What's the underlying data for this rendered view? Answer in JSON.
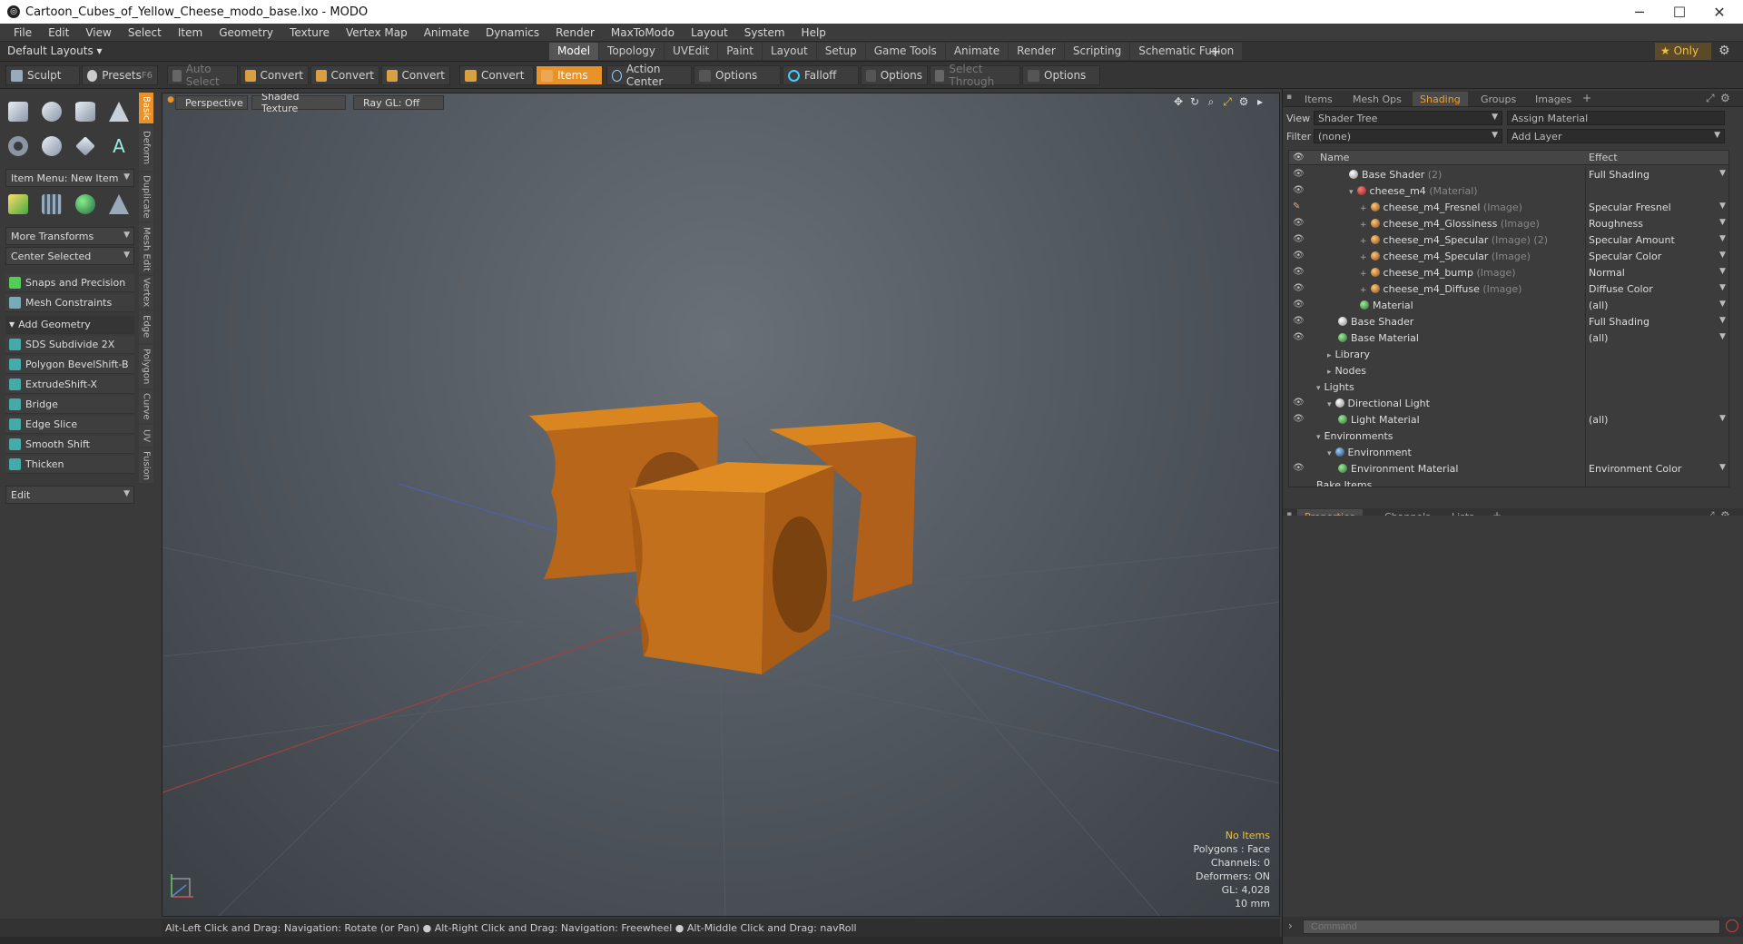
{
  "window": {
    "title": "Cartoon_Cubes_of_Yellow_Cheese_modo_base.lxo - MODO"
  },
  "menu": [
    "File",
    "Edit",
    "View",
    "Select",
    "Item",
    "Geometry",
    "Texture",
    "Vertex Map",
    "Animate",
    "Dynamics",
    "Render",
    "MaxToModo",
    "Layout",
    "System",
    "Help"
  ],
  "layoutbar": {
    "default_layouts": "Default Layouts ▾",
    "tabs": [
      "Model",
      "Topology",
      "UVEdit",
      "Paint",
      "Layout",
      "Setup",
      "Game Tools",
      "Animate",
      "Render",
      "Scripting",
      "Schematic Fusion"
    ],
    "active_tab": "Model",
    "only_label": "★  Only"
  },
  "toolbar": {
    "sculpt": "Sculpt",
    "presets": "Presets",
    "presets_key": "F6",
    "auto_select": "Auto Select",
    "convert": "Convert",
    "items": "Items",
    "action_center": "Action Center",
    "options": "Options",
    "falloff": "Falloff",
    "select_through": "Select Through"
  },
  "leftpanel": {
    "item_menu": "Item Menu: New Item",
    "more_transforms": "More Transforms",
    "center_selected": "Center Selected",
    "snaps": "Snaps and Precision",
    "mesh_constraints": "Mesh Constraints",
    "add_geometry": "Add Geometry",
    "tools": [
      {
        "label": "SDS Subdivide 2X",
        "key": ""
      },
      {
        "label": "Polygon Bevel",
        "key": "Shift-B"
      },
      {
        "label": "Extrude",
        "key": "Shift-X"
      },
      {
        "label": "Bridge",
        "key": ""
      },
      {
        "label": "Edge Slice",
        "key": ""
      },
      {
        "label": "Smooth Shift",
        "key": ""
      },
      {
        "label": "Thicken",
        "key": ""
      }
    ],
    "edit": "Edit",
    "vtabs": [
      "Basic",
      "Deform",
      "Duplicate",
      "Mesh Edit",
      "Vertex",
      "Edge",
      "Polygon",
      "Curve",
      "UV",
      "Fusion"
    ]
  },
  "viewport": {
    "perspective": "Perspective",
    "shading": "Shaded Texture",
    "raygl": "Ray GL: Off",
    "stats": {
      "no_items": "No Items",
      "polygons": "Polygons : Face",
      "channels": "Channels: 0",
      "deformers": "Deformers: ON",
      "gl": "GL: 4,028",
      "unit": "10 mm"
    }
  },
  "statusbar": "Alt-Left Click and Drag: Navigation: Rotate (or Pan) ● Alt-Right Click and Drag: Navigation: Freewheel ● Alt-Middle Click and Drag: navRoll",
  "rightpanel": {
    "tabs": [
      "Items",
      "Mesh Ops",
      "Shading",
      "Groups",
      "Images"
    ],
    "active_tab": "Shading",
    "view_label": "View",
    "view_value": "Shader Tree",
    "assign_material": "Assign Material",
    "filter_label": "Filter",
    "filter_value": "(none)",
    "add_layer": "Add Layer",
    "col_name": "Name",
    "col_effect": "Effect",
    "tree": [
      {
        "name": "Base Shader",
        "tag": "(2)",
        "effect": "Full Shading",
        "indent": 3,
        "ball": "white",
        "eye": true,
        "exp": ""
      },
      {
        "name": "cheese_m4",
        "tag": "(Material)",
        "effect": "",
        "indent": 3,
        "ball": "red",
        "eye": true,
        "exp": "▾"
      },
      {
        "name": "cheese_m4_Fresnel",
        "tag": "(Image)",
        "effect": "Specular Fresnel",
        "indent": 4,
        "ball": "img",
        "eye": false,
        "brush": true,
        "exp": "+"
      },
      {
        "name": "cheese_m4_Glossiness",
        "tag": "(Image)",
        "effect": "Roughness",
        "indent": 4,
        "ball": "img",
        "eye": true,
        "exp": "+"
      },
      {
        "name": "cheese_m4_Specular",
        "tag": "(Image) (2)",
        "effect": "Specular Amount",
        "indent": 4,
        "ball": "img",
        "eye": true,
        "exp": "+"
      },
      {
        "name": "cheese_m4_Specular",
        "tag": "(Image)",
        "effect": "Specular Color",
        "indent": 4,
        "ball": "img",
        "eye": true,
        "exp": "+"
      },
      {
        "name": "cheese_m4_bump",
        "tag": "(Image)",
        "effect": "Normal",
        "indent": 4,
        "ball": "img",
        "eye": true,
        "exp": "+"
      },
      {
        "name": "cheese_m4_Diffuse",
        "tag": "(Image)",
        "effect": "Diffuse Color",
        "indent": 4,
        "ball": "img",
        "eye": true,
        "exp": "+"
      },
      {
        "name": "Material",
        "tag": "",
        "effect": "(all)",
        "indent": 4,
        "ball": "green",
        "eye": true,
        "exp": ""
      },
      {
        "name": "Base Shader",
        "tag": "",
        "effect": "Full Shading",
        "indent": 2,
        "ball": "white",
        "eye": true,
        "exp": ""
      },
      {
        "name": "Base Material",
        "tag": "",
        "effect": "(all)",
        "indent": 2,
        "ball": "green",
        "eye": true,
        "exp": ""
      },
      {
        "name": "Library",
        "tag": "",
        "effect": "",
        "indent": 1,
        "ball": "",
        "eye": false,
        "exp": "▸"
      },
      {
        "name": "Nodes",
        "tag": "",
        "effect": "",
        "indent": 1,
        "ball": "",
        "eye": false,
        "exp": "▸"
      },
      {
        "name": "Lights",
        "tag": "",
        "effect": "",
        "indent": 0,
        "ball": "",
        "eye": false,
        "exp": "▾"
      },
      {
        "name": "Directional Light",
        "tag": "",
        "effect": "",
        "indent": 1,
        "ball": "light",
        "eye": true,
        "exp": "▾"
      },
      {
        "name": "Light Material",
        "tag": "",
        "effect": "(all)",
        "indent": 2,
        "ball": "green",
        "eye": true,
        "exp": ""
      },
      {
        "name": "Environments",
        "tag": "",
        "effect": "",
        "indent": 0,
        "ball": "",
        "eye": false,
        "exp": "▾"
      },
      {
        "name": "Environment",
        "tag": "",
        "effect": "",
        "indent": 1,
        "ball": "blue",
        "eye": false,
        "exp": "▾"
      },
      {
        "name": "Environment Material",
        "tag": "",
        "effect": "Environment Color",
        "indent": 2,
        "ball": "green",
        "eye": true,
        "exp": ""
      },
      {
        "name": "Bake Items",
        "tag": "",
        "effect": "",
        "indent": 0,
        "ball": "",
        "eye": false,
        "exp": ""
      }
    ],
    "lower_tabs": [
      "Properties",
      "Channels",
      "Lists"
    ],
    "lower_active": "Properties",
    "command_placeholder": "Command"
  },
  "colors": {
    "accent": "#e8922a",
    "cheese": "#c8741a"
  }
}
